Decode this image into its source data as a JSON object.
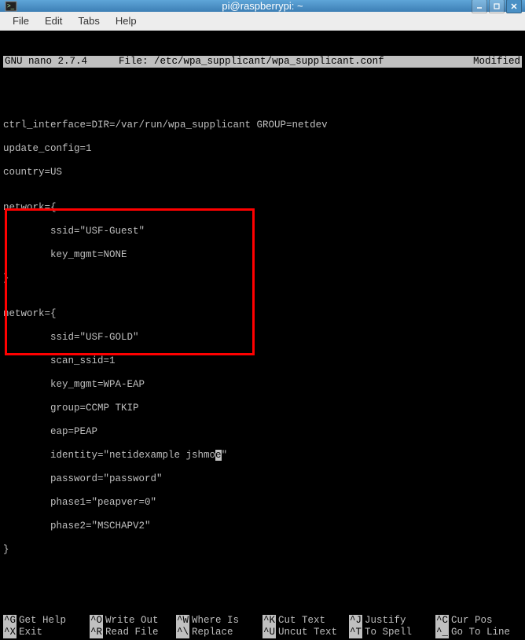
{
  "titlebar": {
    "title": "pi@raspberrypi: ~"
  },
  "menubar": {
    "file": "File",
    "edit": "Edit",
    "tabs": "Tabs",
    "help": "Help"
  },
  "nano": {
    "version": "GNU nano 2.7.4",
    "file_label": "File: /etc/wpa_supplicant/wpa_supplicant.conf",
    "status": "Modified"
  },
  "content": {
    "line1": "ctrl_interface=DIR=/var/run/wpa_supplicant GROUP=netdev",
    "line2": "update_config=1",
    "line3": "country=US",
    "line4": "",
    "line5": "network={",
    "line6": "        ssid=\"USF-Guest\"",
    "line7": "        key_mgmt=NONE",
    "line8": "}",
    "line9": "",
    "line10": "network={",
    "line11": "        ssid=\"USF-GOLD\"",
    "line12": "        scan_ssid=1",
    "line13": "        key_mgmt=WPA-EAP",
    "line14": "        group=CCMP TKIP",
    "line15": "        eap=PEAP",
    "line16a": "        identity=\"netidexample jshmo",
    "line16b": "e",
    "line16c": "\"",
    "line17": "        password=\"password\"",
    "line18": "        phase1=\"peapver=0\"",
    "line19": "        phase2=\"MSCHAPV2\"",
    "line20": "}"
  },
  "shortcuts": {
    "r1c1k": "^G",
    "r1c1l": "Get Help",
    "r1c2k": "^O",
    "r1c2l": "Write Out",
    "r1c3k": "^W",
    "r1c3l": "Where Is",
    "r1c4k": "^K",
    "r1c4l": "Cut Text",
    "r1c5k": "^J",
    "r1c5l": "Justify",
    "r1c6k": "^C",
    "r1c6l": "Cur Pos",
    "r2c1k": "^X",
    "r2c1l": "Exit",
    "r2c2k": "^R",
    "r2c2l": "Read File",
    "r2c3k": "^\\",
    "r2c3l": "Replace",
    "r2c4k": "^U",
    "r2c4l": "Uncut Text",
    "r2c5k": "^T",
    "r2c5l": "To Spell",
    "r2c6k": "^_",
    "r2c6l": "Go To Line"
  }
}
